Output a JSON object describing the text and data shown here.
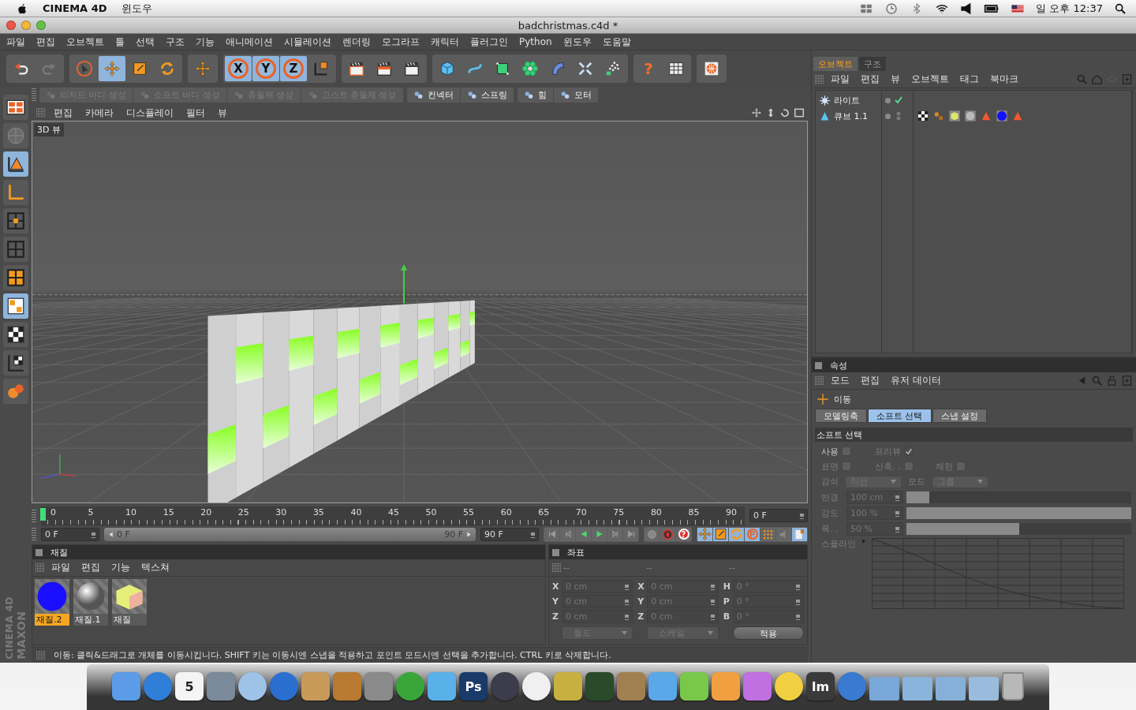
{
  "mac_menubar": {
    "app_name": "CINEMA 4D",
    "menus": [
      "윈도우"
    ],
    "clock": "일 오후 12:37"
  },
  "window": {
    "title": "badchristmas.c4d *"
  },
  "menu": [
    "파일",
    "편집",
    "오브젝트",
    "툴",
    "선택",
    "구조",
    "기능",
    "애니메이션",
    "시뮬레이션",
    "렌더링",
    "모그라프",
    "캐릭터",
    "플러그인",
    "Python",
    "윈도우",
    "도움말"
  ],
  "toolbar": [
    [
      {
        "kind": "undo",
        "selected": false
      },
      {
        "kind": "redo",
        "selected": false
      }
    ],
    [
      {
        "kind": "select",
        "selected": false
      },
      {
        "kind": "move",
        "selected": true
      },
      {
        "kind": "scale",
        "selected": false
      },
      {
        "kind": "rotate",
        "selected": false
      }
    ],
    [
      {
        "kind": "axis",
        "selected": false
      }
    ],
    [
      {
        "kind": "axis-lock",
        "label": "X",
        "selected": true
      },
      {
        "kind": "axis-lock",
        "label": "Y",
        "selected": true
      },
      {
        "kind": "axis-lock",
        "label": "Z",
        "selected": true
      },
      {
        "kind": "coord",
        "selected": false
      }
    ],
    [
      {
        "kind": "render-view",
        "selected": false
      },
      {
        "kind": "render",
        "selected": false
      },
      {
        "kind": "render-settings",
        "selected": false
      }
    ],
    [
      {
        "kind": "cube",
        "selected": false
      },
      {
        "kind": "spline",
        "selected": false
      },
      {
        "kind": "nurbs",
        "selected": false
      },
      {
        "kind": "array",
        "selected": false
      },
      {
        "kind": "deformer",
        "selected": false
      },
      {
        "kind": "scene",
        "selected": false
      },
      {
        "kind": "particles",
        "selected": false
      }
    ],
    [
      {
        "kind": "help",
        "label": "?",
        "selected": false
      },
      {
        "kind": "help-table",
        "selected": false
      }
    ],
    [
      {
        "kind": "web",
        "selected": false
      }
    ]
  ],
  "left_tools": [
    {
      "kind": "layout",
      "selected": false
    },
    {
      "kind": "sculpt",
      "selected": false
    },
    {
      "kind": "model",
      "selected": true
    },
    {
      "kind": "axis-mode",
      "selected": false
    },
    {
      "kind": "points",
      "selected": false
    },
    {
      "kind": "edges",
      "selected": false
    },
    {
      "kind": "polygons",
      "selected": false
    },
    {
      "kind": "uv",
      "selected": true
    },
    {
      "kind": "texture",
      "selected": false
    },
    {
      "kind": "texture-axis",
      "selected": false
    },
    {
      "kind": "workplane",
      "selected": false
    }
  ],
  "logo": [
    "MAXON",
    "CINEMA 4D"
  ],
  "dynamics_toolbar": [
    [
      {
        "label": "리지드 바디 생성",
        "disabled": true
      },
      {
        "label": "소프트 바디 생성",
        "disabled": true
      },
      {
        "label": "충돌체 생성",
        "disabled": true
      },
      {
        "label": "고스트 충돌체 생성",
        "disabled": true
      }
    ],
    [
      {
        "label": "컨넥터",
        "disabled": false
      },
      {
        "label": "스프링",
        "disabled": false
      }
    ],
    [
      {
        "label": "힘",
        "disabled": false
      },
      {
        "label": "모터",
        "disabled": false
      }
    ]
  ],
  "viewport": {
    "menu": [
      "편집",
      "카메라",
      "디스플레이",
      "필터",
      "뷰"
    ],
    "label": "3D 뷰"
  },
  "timeline": {
    "ticks": [
      "0",
      "5",
      "10",
      "15",
      "20",
      "25",
      "30",
      "35",
      "40",
      "45",
      "50",
      "55",
      "60",
      "65",
      "70",
      "75",
      "80",
      "85",
      "90"
    ],
    "frame": "0 F",
    "level": 0
  },
  "playback": {
    "start": "0 F",
    "range_start": "0 F",
    "range_end": "90 F",
    "range": {
      "level": 1
    },
    "end": "90 F",
    "transport": [
      {
        "kind": "first"
      },
      {
        "kind": "prev"
      },
      {
        "kind": "play-back"
      },
      {
        "kind": "play"
      },
      {
        "kind": "next"
      },
      {
        "kind": "last"
      }
    ],
    "keys": [
      {
        "kind": "autokey"
      },
      {
        "kind": "record"
      },
      {
        "kind": "key-help",
        "label": "?"
      }
    ],
    "modes": [
      {
        "kind": "move",
        "selected": true
      },
      {
        "kind": "scale",
        "selected": true
      },
      {
        "kind": "rotate",
        "selected": true
      },
      {
        "kind": "param",
        "label": "P",
        "selected": true
      },
      {
        "kind": "points",
        "selected": false
      },
      {
        "kind": "sound",
        "selected": false
      },
      {
        "kind": "doc",
        "selected": true
      }
    ]
  },
  "materials": {
    "title": "재질",
    "menu": [
      "파일",
      "편집",
      "기능",
      "텍스쳐"
    ],
    "items": [
      {
        "name": "재질.2",
        "kind": "flat",
        "selected": true
      },
      {
        "name": "재질.1",
        "kind": "shiny",
        "selected": false
      },
      {
        "name": "재질",
        "kind": "cube",
        "selected": false
      }
    ]
  },
  "coordinates": {
    "title": "좌표",
    "columns": [
      "--",
      "--",
      "--"
    ],
    "rows": [
      [
        {
          "axis": "X",
          "value": "0 cm"
        },
        {
          "axis": "X",
          "value": "0 cm"
        },
        {
          "axis": "H",
          "value": "0 °"
        }
      ],
      [
        {
          "axis": "Y",
          "value": "0 cm"
        },
        {
          "axis": "Y",
          "value": "0 cm"
        },
        {
          "axis": "P",
          "value": "0 °"
        }
      ],
      [
        {
          "axis": "Z",
          "value": "0 cm"
        },
        {
          "axis": "Z",
          "value": "0 cm"
        },
        {
          "axis": "B",
          "value": "0 °"
        }
      ]
    ],
    "dropdowns": [
      "월드",
      "스케일"
    ],
    "apply": "적용"
  },
  "status_bar": "이동: 클릭&드래그로 개체를 이동시킵니다. SHIFT 키는 이동시엔 스냅을 적용하고 포인트 모드시엔 선택을 추가합니다. CTRL 키로 삭제합니다.",
  "objects": {
    "tabs": [
      {
        "label": "오브젝트",
        "selected": true
      },
      {
        "label": "구조",
        "selected": false
      }
    ],
    "menu": [
      "파일",
      "편집",
      "뷰",
      "오브젝트",
      "태그",
      "북마크"
    ],
    "items": [
      {
        "name": "라이트",
        "kind": "light",
        "enabled": true
      },
      {
        "name": "큐브 1.1",
        "kind": "instance",
        "enabled": false,
        "tags": [
          {
            "kind": "checker"
          },
          {
            "kind": "dots"
          },
          {
            "kind": "cube-material"
          },
          {
            "kind": "shiny-material"
          },
          {
            "kind": "cone"
          },
          {
            "kind": "flat-material"
          },
          {
            "kind": "cone"
          }
        ]
      }
    ]
  },
  "attributes": {
    "title": "속성",
    "menu": [
      "모드",
      "편집",
      "유저 데이터"
    ],
    "tool": "이동",
    "tabs": [
      {
        "label": "모델링축",
        "selected": false
      },
      {
        "label": "소프트 선택",
        "selected": true
      },
      {
        "label": "스냅 설정",
        "selected": false
      }
    ],
    "section": "소프트 선택",
    "checks": [
      [
        {
          "label": "사용",
          "checked": false,
          "disabled": false
        },
        {
          "label": "프리뷰",
          "checked": true,
          "disabled": true
        }
      ],
      [
        {
          "label": "표면",
          "checked": false,
          "disabled": true
        },
        {
          "label": "신축. .",
          "checked": false,
          "disabled": true
        },
        {
          "label": "제한",
          "checked": false,
          "disabled": true
        }
      ]
    ],
    "dropdowns": [
      {
        "label": "감쇠",
        "value": "직선"
      },
      {
        "label": "모드",
        "value": "그룹"
      }
    ],
    "sliders": [
      {
        "label": "반경",
        "value": "100 cm",
        "level": 0.1
      },
      {
        "label": "강도",
        "value": "100 %",
        "level": 1
      },
      {
        "label": "폭. .",
        "value": "50 %",
        "level": 0.5
      }
    ],
    "spline_label": "스플라인"
  },
  "dock": [
    {
      "kind": "app",
      "color": "#5b9be8"
    },
    {
      "kind": "round",
      "color": "#2f7fd8"
    },
    {
      "kind": "app",
      "color": "#f4f4f4",
      "label": "5"
    },
    {
      "kind": "app",
      "color": "#7a8a9a"
    },
    {
      "kind": "round",
      "color": "#9fc3e8"
    },
    {
      "kind": "round",
      "color": "#2a6fd0"
    },
    {
      "kind": "app",
      "color": "#c89a5a"
    },
    {
      "kind": "app",
      "color": "#b87a30"
    },
    {
      "kind": "app",
      "color": "#8a8a8a"
    },
    {
      "kind": "round",
      "color": "#3aa63a"
    },
    {
      "kind": "app",
      "color": "#5ab0e8"
    },
    {
      "kind": "app",
      "color": "#1a3a6a",
      "label": "Ps"
    },
    {
      "kind": "round",
      "color": "#3c3c4c"
    },
    {
      "kind": "round",
      "color": "#f0f0f0"
    },
    {
      "kind": "app",
      "color": "#c8b040"
    },
    {
      "kind": "app",
      "color": "#2a4a2a"
    },
    {
      "kind": "app",
      "color": "#a08050"
    },
    {
      "kind": "app",
      "color": "#5aa8e8"
    },
    {
      "kind": "app",
      "color": "#7ac84a"
    },
    {
      "kind": "app",
      "color": "#f0a040"
    },
    {
      "kind": "app",
      "color": "#c070e0"
    },
    {
      "kind": "round",
      "color": "#f0d040"
    },
    {
      "kind": "app",
      "color": "#3a3a3a",
      "label": "lm"
    },
    {
      "kind": "round",
      "color": "#3a7ad0"
    },
    {
      "kind": "folder",
      "color": "#7aa8d8"
    },
    {
      "kind": "folder",
      "color": "#8ab4dc"
    },
    {
      "kind": "folder",
      "color": "#86b0d8"
    },
    {
      "kind": "folder",
      "color": "#9abcdc"
    },
    {
      "kind": "trash",
      "color": "#b8b8b8"
    }
  ]
}
